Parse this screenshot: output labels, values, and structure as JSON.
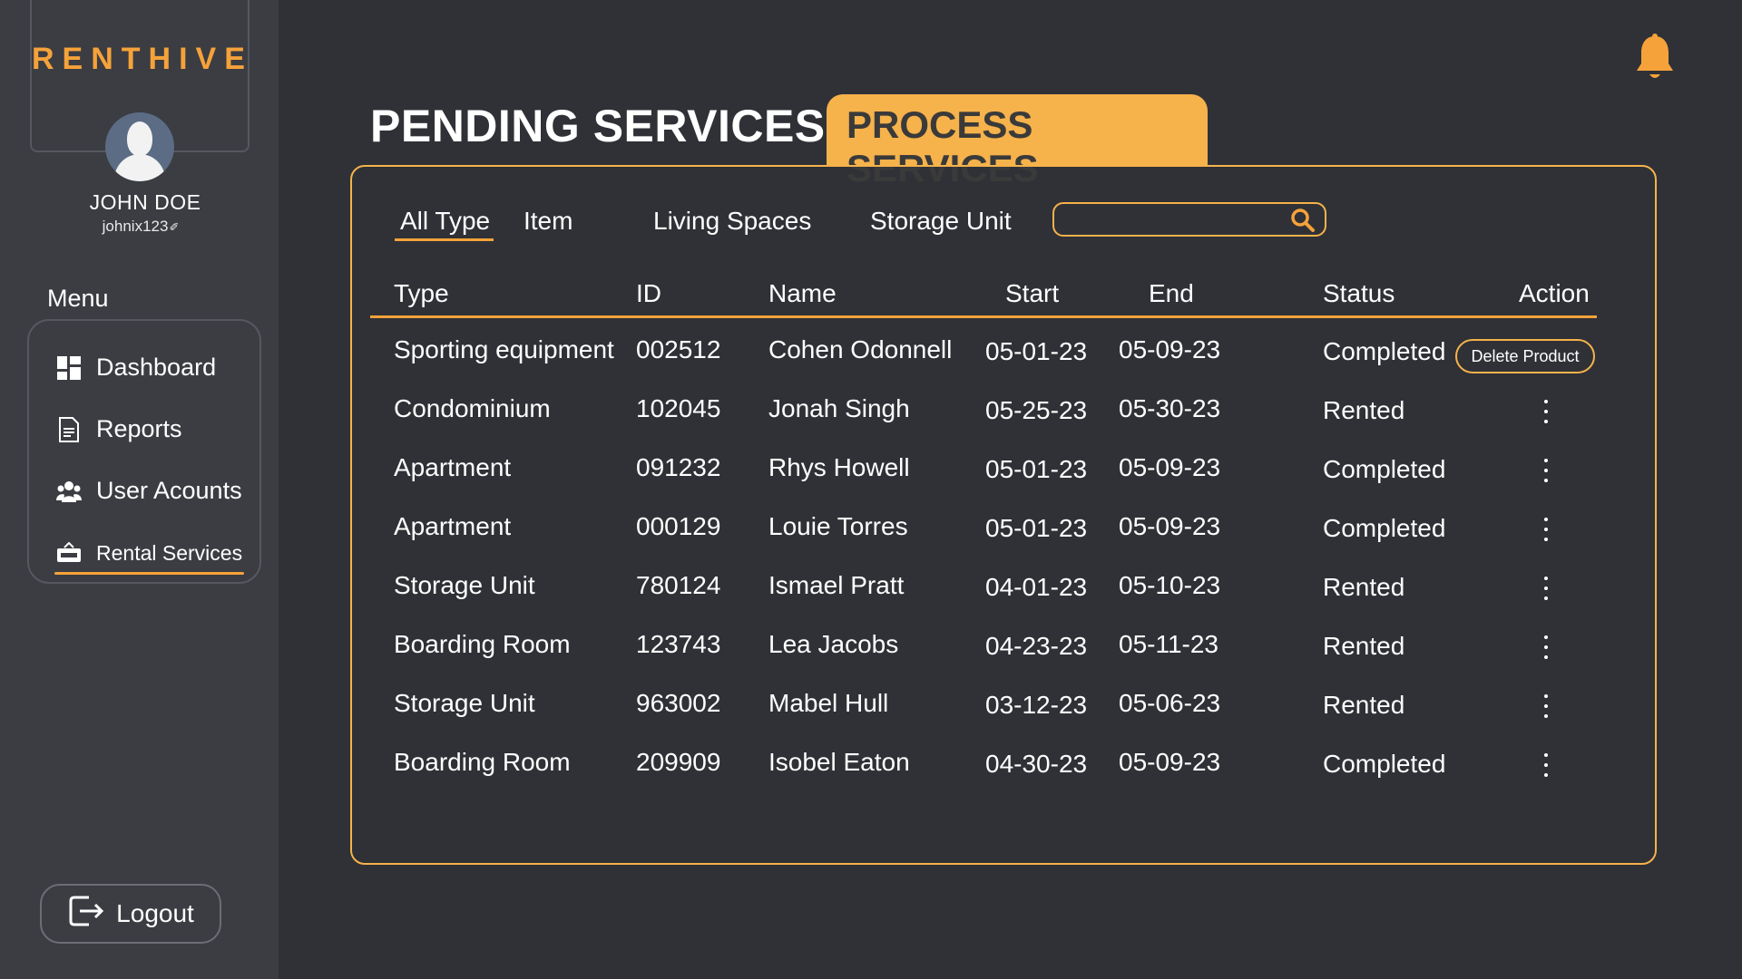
{
  "brand": {
    "logo": "RENTHIVE"
  },
  "user": {
    "name": "JOHN DOE",
    "handle": "johnix123",
    "edit_glyph": "✐"
  },
  "menu": {
    "label": "Menu",
    "items": [
      {
        "label": "Dashboard",
        "icon": "dashboard-icon"
      },
      {
        "label": "Reports",
        "icon": "reports-icon"
      },
      {
        "label": "User Acounts",
        "icon": "users-icon"
      },
      {
        "label": "Rental Services",
        "icon": "rent-sign-icon",
        "active": true
      }
    ]
  },
  "logout": {
    "label": "Logout"
  },
  "header": {
    "title": "PENDING SERVICES",
    "tab_process": "PROCESS SERVICES"
  },
  "filters": [
    {
      "label": "All Type",
      "active": true
    },
    {
      "label": "Item"
    },
    {
      "label": "Living Spaces"
    },
    {
      "label": "Storage Unit"
    }
  ],
  "search": {
    "value": "",
    "placeholder": ""
  },
  "table": {
    "columns": [
      "Type",
      "ID",
      "Name",
      "Start",
      "End",
      "Status",
      "Action"
    ],
    "rows": [
      {
        "type": "Sporting equipment",
        "id": "002512",
        "name": "Cohen Odonnell",
        "start": "05-01-23",
        "end": "05-09-23",
        "status": "Completed",
        "action": "Delete Product"
      },
      {
        "type": "Condominium",
        "id": "102045",
        "name": "Jonah Singh",
        "start": "05-25-23",
        "end": "05-30-23",
        "status": "Rented"
      },
      {
        "type": "Apartment",
        "id": "091232",
        "name": "Rhys Howell",
        "start": "05-01-23",
        "end": "05-09-23",
        "status": "Completed"
      },
      {
        "type": "Apartment",
        "id": "000129",
        "name": "Louie Torres",
        "start": "05-01-23",
        "end": "05-09-23",
        "status": "Completed"
      },
      {
        "type": "Storage Unit",
        "id": "780124",
        "name": "Ismael Pratt",
        "start": "04-01-23",
        "end": "05-10-23",
        "status": "Rented"
      },
      {
        "type": "Boarding Room",
        "id": "123743",
        "name": "Lea Jacobs",
        "start": "04-23-23",
        "end": "05-11-23",
        "status": "Rented"
      },
      {
        "type": "Storage Unit",
        "id": "963002",
        "name": "Mabel Hull",
        "start": "03-12-23",
        "end": "05-06-23",
        "status": "Rented"
      },
      {
        "type": "Boarding Room",
        "id": "209909",
        "name": "Isobel Eaton",
        "start": "04-30-23",
        "end": "05-09-23",
        "status": "Completed"
      }
    ]
  },
  "colors": {
    "accent": "#f6a23a",
    "tab_bg": "#f6b24b",
    "background": "#2f3136",
    "sidebar": "#3b3d42"
  }
}
